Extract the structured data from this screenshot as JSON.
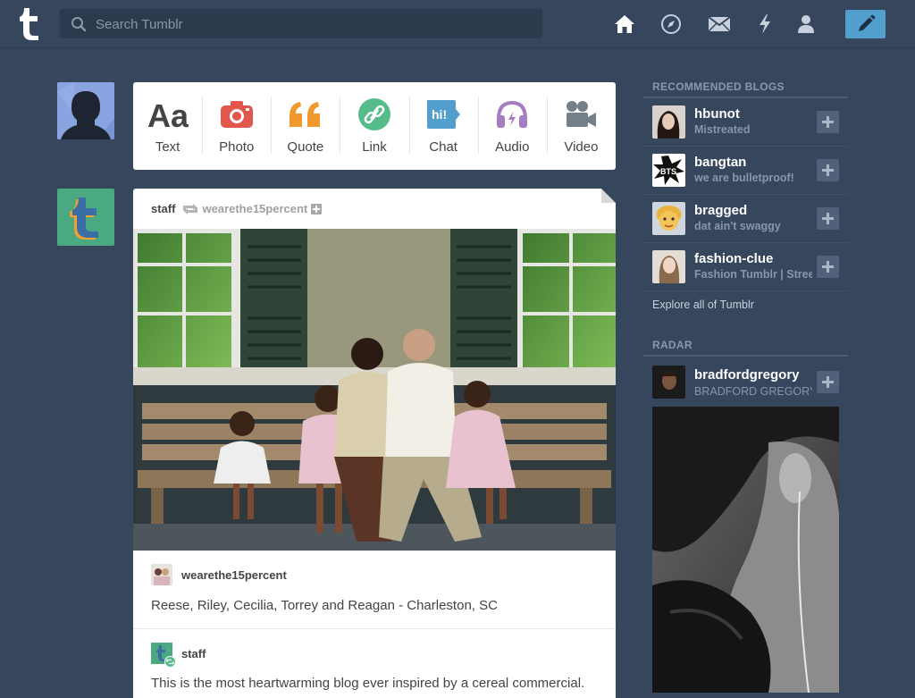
{
  "header": {
    "search_placeholder": "Search Tumblr",
    "nav_icons": [
      "home-icon",
      "compass-icon",
      "mail-icon",
      "lightning-icon",
      "account-icon"
    ],
    "compose_icon": "pencil-icon",
    "accent": "#529ecc",
    "background": "#36465d"
  },
  "post_types": [
    {
      "label": "Text",
      "icon": "text-aa-icon",
      "color": "#444444"
    },
    {
      "label": "Photo",
      "icon": "camera-icon",
      "color": "#e2574c"
    },
    {
      "label": "Quote",
      "icon": "quote-icon",
      "color": "#f2992e"
    },
    {
      "label": "Link",
      "icon": "link-icon",
      "color": "#56bc8a"
    },
    {
      "label": "Chat",
      "icon": "chat-icon",
      "color": "#529ecc"
    },
    {
      "label": "Audio",
      "icon": "headphones-icon",
      "color": "#a77dc2"
    },
    {
      "label": "Video",
      "icon": "video-camera-icon",
      "color": "#748089"
    }
  ],
  "post": {
    "blog_name": "staff",
    "reblogged_from": "wearethe15percent",
    "photo_alt": "Family of five sitting on a wooden bench",
    "source_blog": "wearethe15percent",
    "caption": "Reese, Riley, Cecilia, Torrey and Reagan - Charleston, SC",
    "commenter_blog": "staff",
    "comment_text": "This is the most heartwarming blog ever inspired by a cereal commercial."
  },
  "sidebar": {
    "recommended_title": "RECOMMENDED BLOGS",
    "recommended": [
      {
        "name": "hbunot",
        "subtitle": "Mistreated"
      },
      {
        "name": "bangtan",
        "subtitle": "we are bulletproof!"
      },
      {
        "name": "bragged",
        "subtitle": "dat ain't swaggy"
      },
      {
        "name": "fashion-clue",
        "subtitle": "Fashion Tumblr | Street"
      }
    ],
    "explore_label": "Explore all of Tumblr",
    "radar_title": "RADAR",
    "radar": {
      "name": "bradfordgregory",
      "subtitle": "BRADFORD GREGORY"
    }
  }
}
